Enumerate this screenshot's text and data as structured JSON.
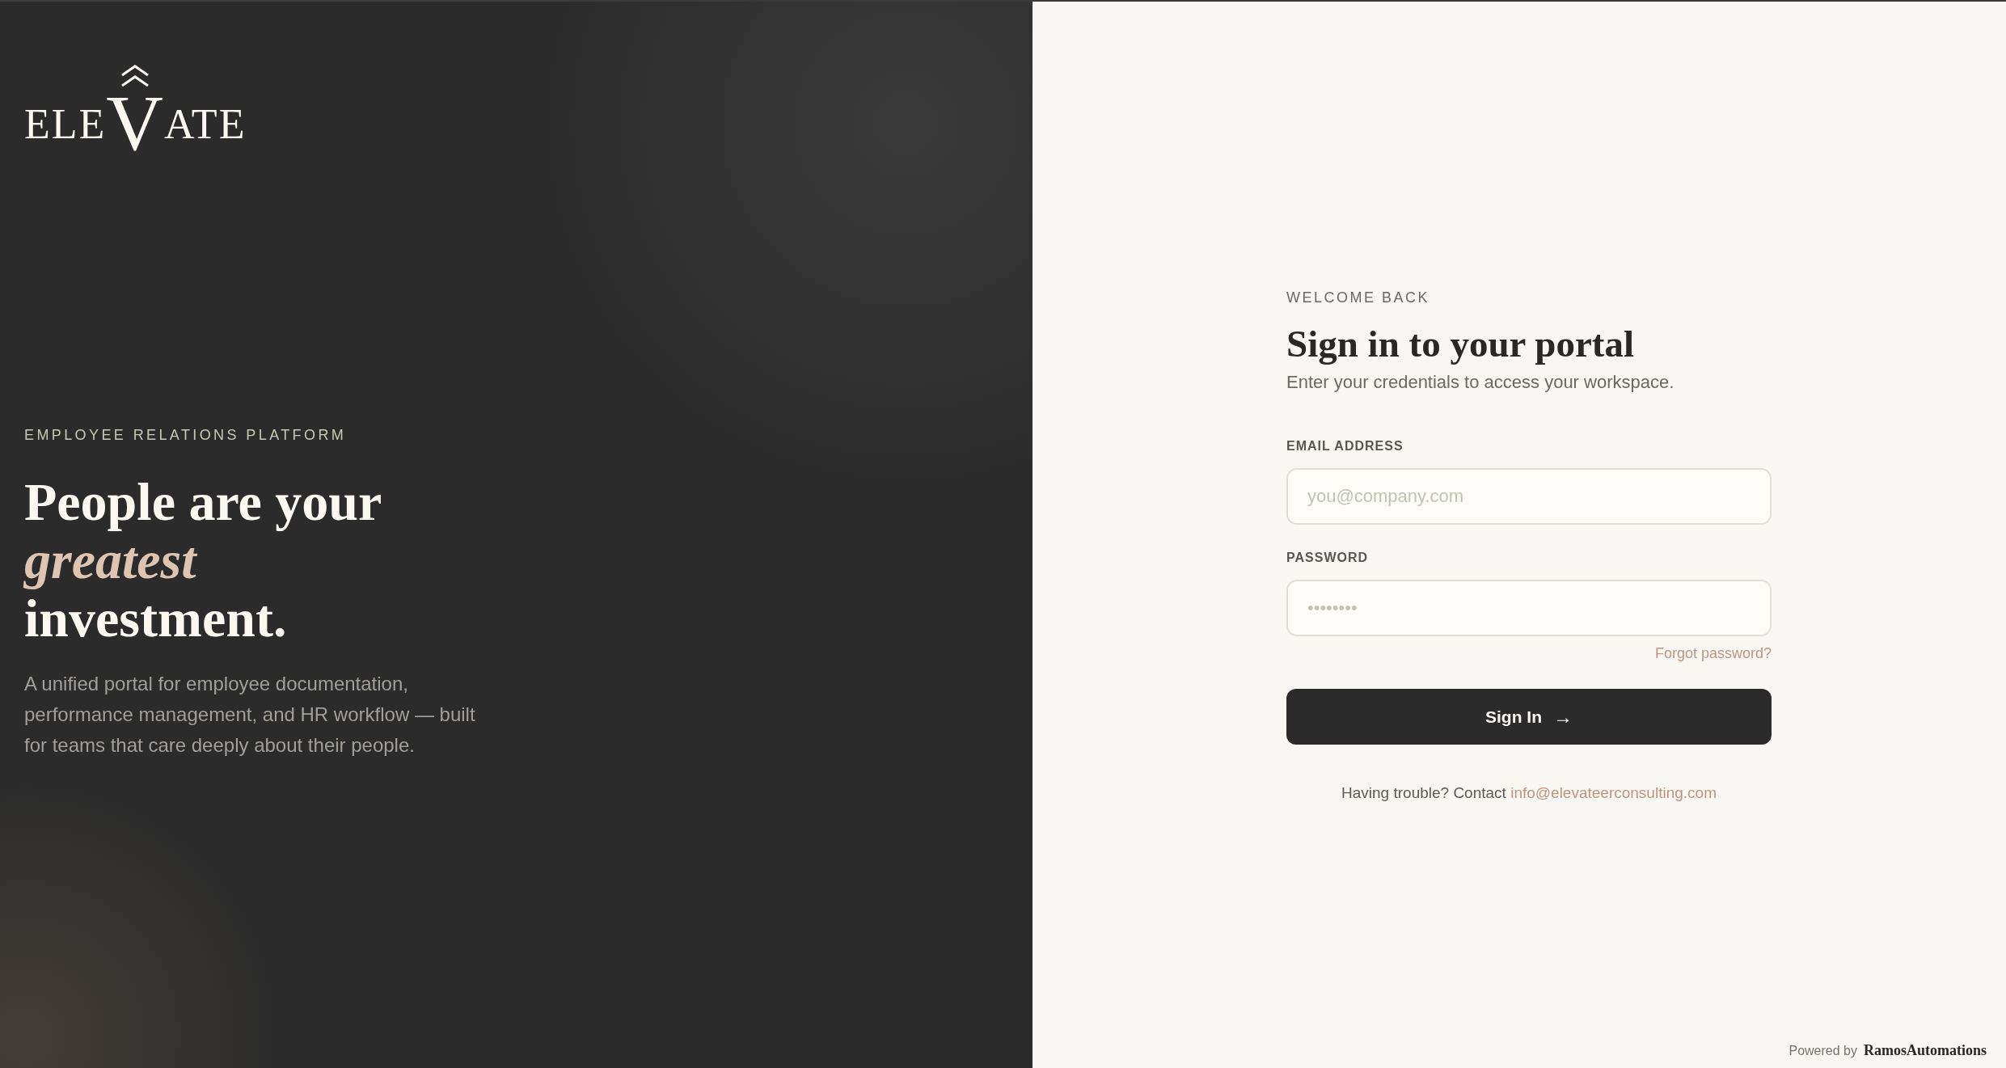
{
  "brand_panel": {
    "logo": {
      "before": "ELE",
      "accent": "V",
      "after": "ATE"
    },
    "eyebrow": "EMPLOYEE RELATIONS PLATFORM",
    "headline": "People are your *greatest* investment.",
    "description": "A unified portal for employee documentation, performance management, and HR workflow — built for teams that care deeply about their people."
  },
  "sign_in": {
    "eyebrow": "WELCOME BACK",
    "title": "Sign in to your portal",
    "subtitle": "Enter your credentials to access your workspace.",
    "fields": [
      {
        "label": "EMAIL ADDRESS",
        "placeholder": "you@company.com"
      },
      {
        "label": "PASSWORD",
        "placeholder": "••••••••"
      }
    ],
    "forgot_link": "Forgot password?",
    "submit_button": {
      "label": "Sign In",
      "arrow": "→"
    },
    "help": {
      "text": "Having trouble? Contact",
      "link": "info@elevateerconsulting.com"
    }
  },
  "footer": {
    "prefix": "Powered by",
    "brand": "RamosAutomations"
  }
}
